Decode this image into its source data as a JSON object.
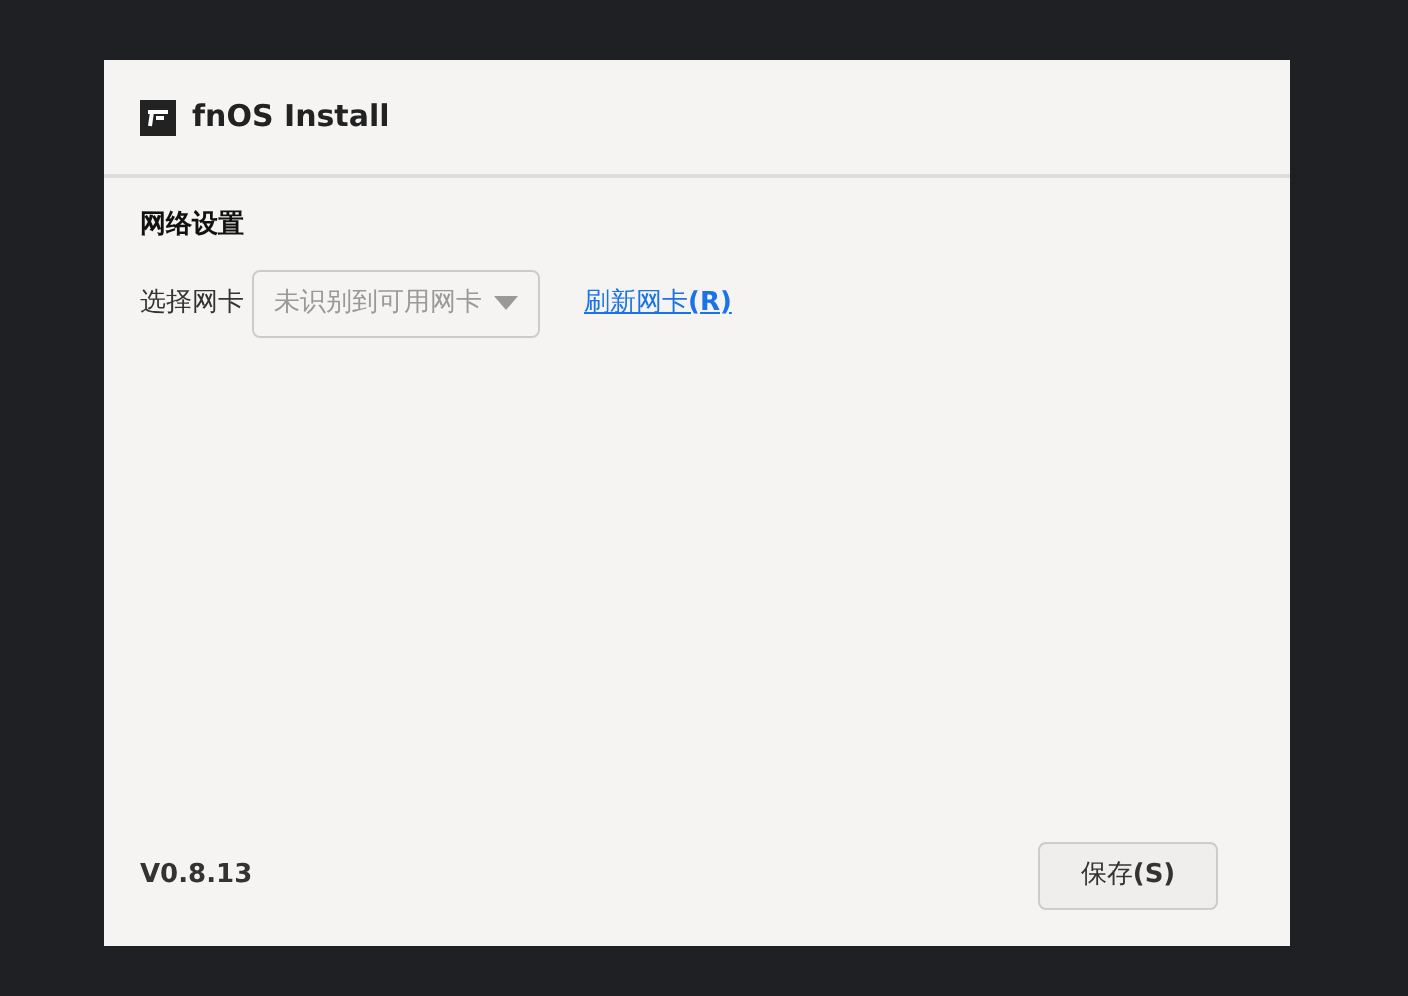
{
  "window": {
    "title": "fnOS Install"
  },
  "section": {
    "title": "网络设置"
  },
  "network_card": {
    "label": "选择网卡",
    "placeholder": "未识别到可用网卡"
  },
  "refresh_link": "刷新网卡**(R)**",
  "version": "V0.8.13",
  "save_button": "保存**(S)**"
}
